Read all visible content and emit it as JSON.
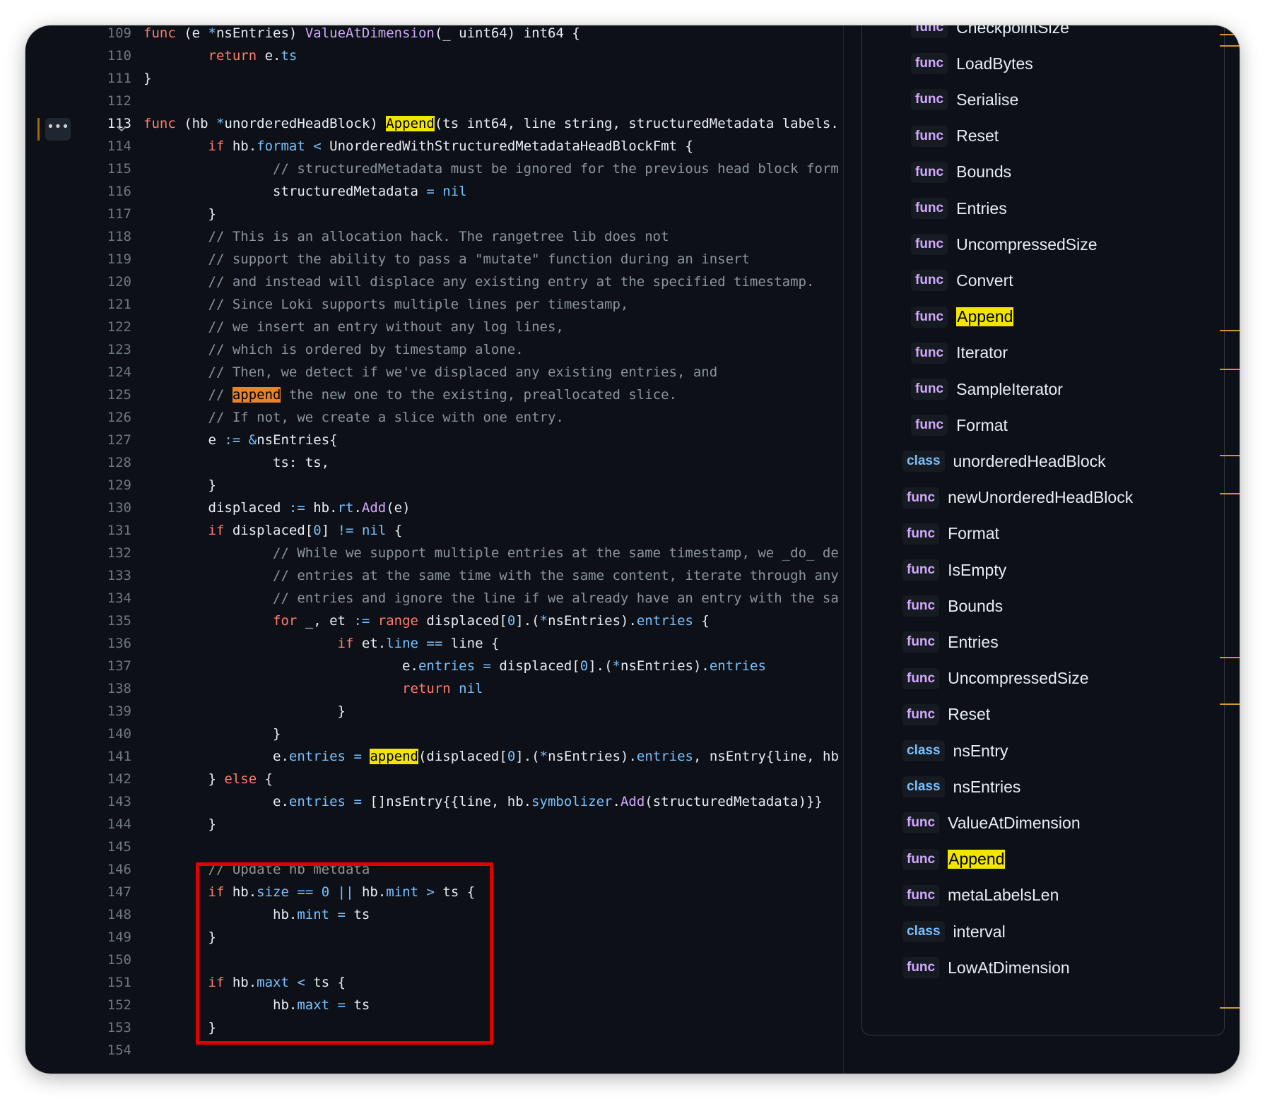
{
  "editor": {
    "current_line": 113,
    "lines": [
      {
        "n": 109,
        "html": "<span class=\"kw\">func</span> (e <span class=\"op\">*</span>nsEntries) <span class=\"fn\">ValueAtDimension</span>(_ uint64) int64 {"
      },
      {
        "n": 110,
        "html": "        <span class=\"kw\">return</span> e.<span class=\"pr\">ts</span>"
      },
      {
        "n": 111,
        "html": "}"
      },
      {
        "n": 112,
        "html": ""
      },
      {
        "n": 113,
        "html": "<span class=\"kw\">func</span> (hb <span class=\"op\">*</span>unorderedHeadBlock) <span class=\"hl-y\">Append</span>(ts int64, line string, structuredMetadata labels."
      },
      {
        "n": 114,
        "html": "        <span class=\"kw\">if</span> hb.<span class=\"pr\">format</span> <span class=\"op\">&lt;</span> UnorderedWithStructuredMetadataHeadBlockFmt {"
      },
      {
        "n": 115,
        "html": "                <span class=\"cm\">// structuredMetadata must be ignored for the previous head block form</span>"
      },
      {
        "n": 116,
        "html": "                structuredMetadata <span class=\"op\">=</span> <span class=\"pr\">nil</span>"
      },
      {
        "n": 117,
        "html": "        }"
      },
      {
        "n": 118,
        "html": "        <span class=\"cm\">// This is an allocation hack. The rangetree lib does not</span>"
      },
      {
        "n": 119,
        "html": "        <span class=\"cm\">// support the ability to pass a \"mutate\" function during an insert</span>"
      },
      {
        "n": 120,
        "html": "        <span class=\"cm\">// and instead will displace any existing entry at the specified timestamp.</span>"
      },
      {
        "n": 121,
        "html": "        <span class=\"cm\">// Since Loki supports multiple lines per timestamp,</span>"
      },
      {
        "n": 122,
        "html": "        <span class=\"cm\">// we insert an entry without any log lines,</span>"
      },
      {
        "n": 123,
        "html": "        <span class=\"cm\">// which is ordered by timestamp alone.</span>"
      },
      {
        "n": 124,
        "html": "        <span class=\"cm\">// Then, we detect if we've displaced any existing entries, and</span>"
      },
      {
        "n": 125,
        "html": "        <span class=\"cm\">// <span class=\"hl-o\">append</span> the new one to the existing, preallocated slice.</span>"
      },
      {
        "n": 126,
        "html": "        <span class=\"cm\">// If not, we create a slice with one entry.</span>"
      },
      {
        "n": 127,
        "html": "        e <span class=\"op\">:=</span> <span class=\"op\">&amp;</span>nsEntries{"
      },
      {
        "n": 128,
        "html": "                ts: ts,"
      },
      {
        "n": 129,
        "html": "        }"
      },
      {
        "n": 130,
        "html": "        displaced <span class=\"op\">:=</span> hb.<span class=\"pr\">rt</span>.<span class=\"fn\">Add</span>(e)"
      },
      {
        "n": 131,
        "html": "        <span class=\"kw\">if</span> displaced[<span class=\"pr\">0</span>] <span class=\"op\">!=</span> <span class=\"pr\">nil</span> {"
      },
      {
        "n": 132,
        "html": "                <span class=\"cm\">// While we support multiple entries at the same timestamp, we _do_ de</span>"
      },
      {
        "n": 133,
        "html": "                <span class=\"cm\">// entries at the same time with the same content, iterate through any</span>"
      },
      {
        "n": 134,
        "html": "                <span class=\"cm\">// entries and ignore the line if we already have an entry with the sa</span>"
      },
      {
        "n": 135,
        "html": "                <span class=\"kw\">for</span> _, et <span class=\"op\">:=</span> <span class=\"kw\">range</span> displaced[<span class=\"pr\">0</span>].(<span class=\"op\">*</span>nsEntries).<span class=\"pr\">entries</span> {"
      },
      {
        "n": 136,
        "html": "                        <span class=\"kw\">if</span> et.<span class=\"pr\">line</span> <span class=\"op\">==</span> line {"
      },
      {
        "n": 137,
        "html": "                                e.<span class=\"pr\">entries</span> <span class=\"op\">=</span> displaced[<span class=\"pr\">0</span>].(<span class=\"op\">*</span>nsEntries).<span class=\"pr\">entries</span>"
      },
      {
        "n": 138,
        "html": "                                <span class=\"kw\">return</span> <span class=\"pr\">nil</span>"
      },
      {
        "n": 139,
        "html": "                        }"
      },
      {
        "n": 140,
        "html": "                }"
      },
      {
        "n": 141,
        "html": "                e.<span class=\"pr\">entries</span> <span class=\"op\">=</span> <span class=\"hl-y\">append</span>(displaced[<span class=\"pr\">0</span>].(<span class=\"op\">*</span>nsEntries).<span class=\"pr\">entries</span>, nsEntry{line, hb"
      },
      {
        "n": 142,
        "html": "        } <span class=\"kw\">else</span> {"
      },
      {
        "n": 143,
        "html": "                e.<span class=\"pr\">entries</span> <span class=\"op\">=</span> []nsEntry{{line, hb.<span class=\"pr\">symbolizer</span>.<span class=\"fn\">Add</span>(structuredMetadata)}}"
      },
      {
        "n": 144,
        "html": "        }"
      },
      {
        "n": 145,
        "html": ""
      },
      {
        "n": 146,
        "html": "        <span class=\"cm\">// Update hb metdata</span>"
      },
      {
        "n": 147,
        "html": "        <span class=\"kw\">if</span> hb.<span class=\"pr\">size</span> <span class=\"op\">==</span> <span class=\"pr\">0</span> <span class=\"op\">||</span> hb.<span class=\"pr\">mint</span> <span class=\"op\">&gt;</span> ts {"
      },
      {
        "n": 148,
        "html": "                hb.<span class=\"pr\">mint</span> <span class=\"op\">=</span> ts"
      },
      {
        "n": 149,
        "html": "        }"
      },
      {
        "n": 150,
        "html": ""
      },
      {
        "n": 151,
        "html": "        <span class=\"kw\">if</span> hb.<span class=\"pr\">maxt</span> <span class=\"op\">&lt;</span> ts {"
      },
      {
        "n": 152,
        "html": "                hb.<span class=\"pr\">maxt</span> <span class=\"op\">=</span> ts"
      },
      {
        "n": 153,
        "html": "        }"
      },
      {
        "n": 154,
        "html": ""
      }
    ]
  },
  "outline": {
    "items": [
      {
        "kind": "func",
        "name": "CheckpointSize",
        "level": 1
      },
      {
        "kind": "func",
        "name": "LoadBytes",
        "level": 1
      },
      {
        "kind": "func",
        "name": "Serialise",
        "level": 1
      },
      {
        "kind": "func",
        "name": "Reset",
        "level": 1
      },
      {
        "kind": "func",
        "name": "Bounds",
        "level": 1
      },
      {
        "kind": "func",
        "name": "Entries",
        "level": 1
      },
      {
        "kind": "func",
        "name": "UncompressedSize",
        "level": 1
      },
      {
        "kind": "func",
        "name": "Convert",
        "level": 1
      },
      {
        "kind": "func",
        "name": "Append",
        "level": 1,
        "highlight": true
      },
      {
        "kind": "func",
        "name": "Iterator",
        "level": 1
      },
      {
        "kind": "func",
        "name": "SampleIterator",
        "level": 1
      },
      {
        "kind": "func",
        "name": "Format",
        "level": 1
      },
      {
        "kind": "class",
        "name": "unorderedHeadBlock",
        "level": 0
      },
      {
        "kind": "func",
        "name": "newUnorderedHeadBlock",
        "level": 0
      },
      {
        "kind": "func",
        "name": "Format",
        "level": 0
      },
      {
        "kind": "func",
        "name": "IsEmpty",
        "level": 0
      },
      {
        "kind": "func",
        "name": "Bounds",
        "level": 0
      },
      {
        "kind": "func",
        "name": "Entries",
        "level": 0
      },
      {
        "kind": "func",
        "name": "UncompressedSize",
        "level": 0
      },
      {
        "kind": "func",
        "name": "Reset",
        "level": 0
      },
      {
        "kind": "class",
        "name": "nsEntry",
        "level": 0
      },
      {
        "kind": "class",
        "name": "nsEntries",
        "level": 0
      },
      {
        "kind": "func",
        "name": "ValueAtDimension",
        "level": 0
      },
      {
        "kind": "func",
        "name": "Append",
        "level": 0,
        "highlight": true
      },
      {
        "kind": "func",
        "name": "metaLabelsLen",
        "level": 0
      },
      {
        "kind": "class",
        "name": "interval",
        "level": 0
      },
      {
        "kind": "func",
        "name": "LowAtDimension",
        "level": 0
      }
    ]
  },
  "colors": {
    "background": "#0d1117",
    "keyword": "#ff7b72",
    "function": "#d2a8ff",
    "property": "#79c0ff",
    "comment": "#8b949e",
    "search_highlight": "#f2e600",
    "current_match": "#e8832a",
    "annotation_box": "#e00000",
    "scroll_marker": "#d29922"
  }
}
